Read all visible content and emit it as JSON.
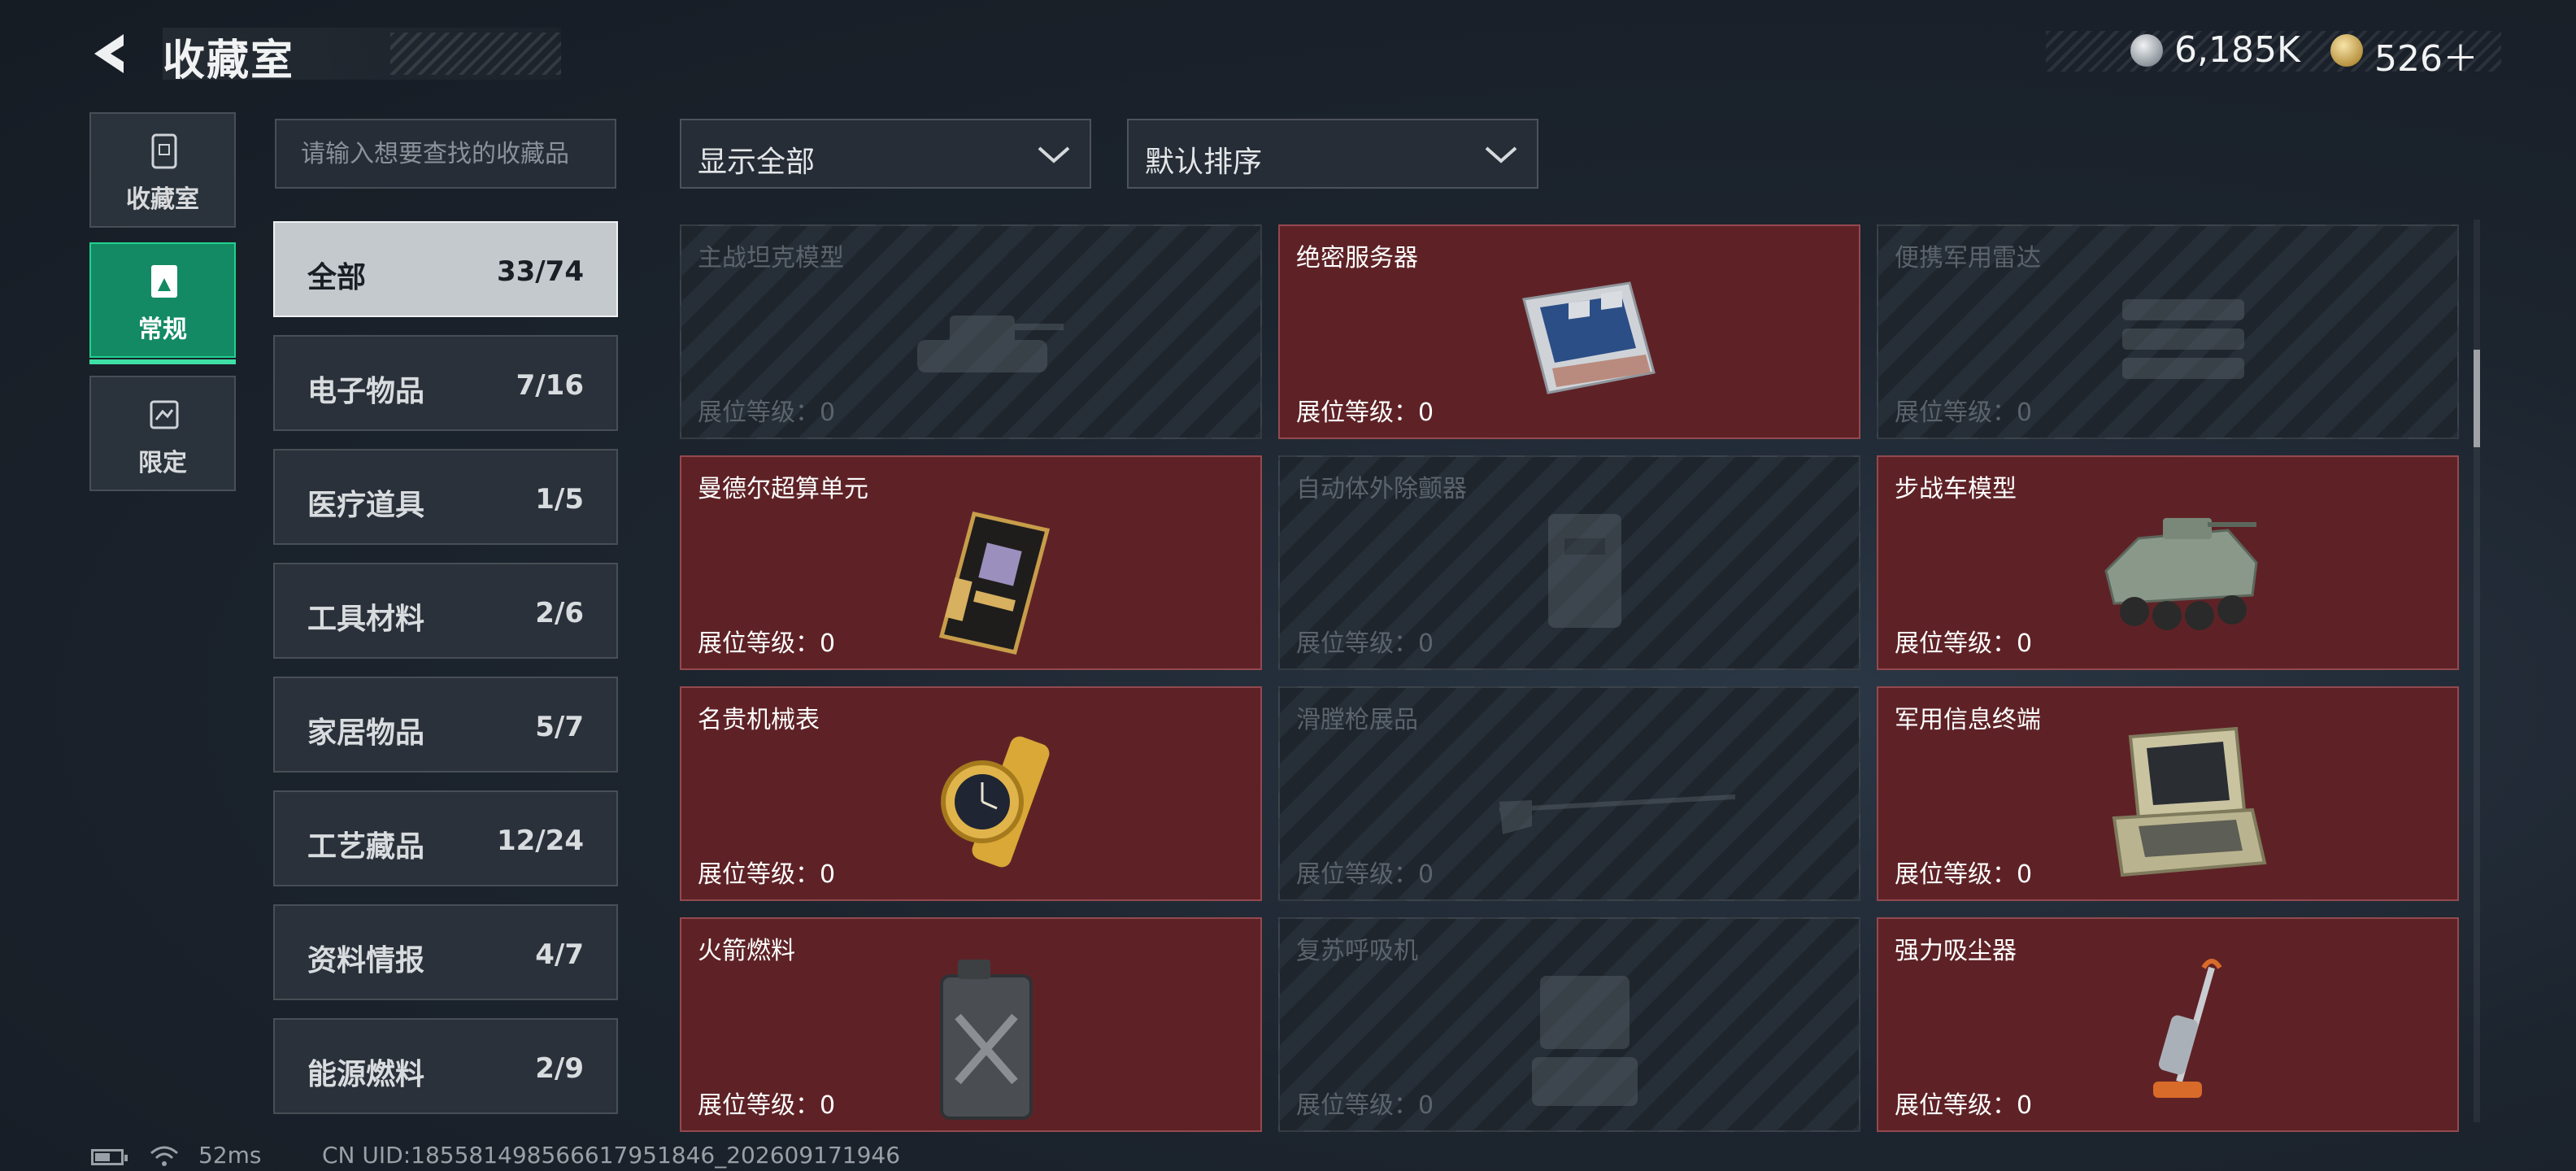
{
  "header": {
    "title": "收藏室",
    "currency1": "6,185K",
    "currency2": "526＋"
  },
  "side_tabs": [
    {
      "label": "收藏室",
      "icon": "archive-icon",
      "active": false
    },
    {
      "label": "常规",
      "icon": "regular-collection-icon",
      "active": true
    },
    {
      "label": "限定",
      "icon": "limited-collection-icon",
      "active": false
    }
  ],
  "search": {
    "placeholder": "请输入想要查找的收藏品"
  },
  "categories": [
    {
      "name": "全部",
      "count": "33/74",
      "active": true
    },
    {
      "name": "电子物品",
      "count": "7/16"
    },
    {
      "name": "医疗道具",
      "count": "1/5"
    },
    {
      "name": "工具材料",
      "count": "2/6"
    },
    {
      "name": "家居物品",
      "count": "5/7"
    },
    {
      "name": "工艺藏品",
      "count": "12/24"
    },
    {
      "name": "资料情报",
      "count": "4/7"
    },
    {
      "name": "能源燃料",
      "count": "2/9"
    }
  ],
  "filters": {
    "show": "显示全部",
    "sort": "默认排序"
  },
  "items": [
    {
      "name": "主战坦克模型",
      "level": "展位等级：0",
      "owned": false,
      "icon": "tank-model-icon"
    },
    {
      "name": "绝密服务器",
      "level": "展位等级：0",
      "owned": true,
      "icon": "server-icon"
    },
    {
      "name": "便携军用雷达",
      "level": "展位等级：0",
      "owned": false,
      "icon": "radar-icon"
    },
    {
      "name": "曼德尔超算单元",
      "level": "展位等级：0",
      "owned": true,
      "icon": "supercomputer-unit-icon"
    },
    {
      "name": "自动体外除颤器",
      "level": "展位等级：0",
      "owned": false,
      "icon": "defibrillator-icon"
    },
    {
      "name": "步战车模型",
      "level": "展位等级：0",
      "owned": true,
      "icon": "ifv-model-icon"
    },
    {
      "name": "名贵机械表",
      "level": "展位等级：0",
      "owned": true,
      "icon": "watch-icon"
    },
    {
      "name": "滑膛枪展品",
      "level": "展位等级：0",
      "owned": false,
      "icon": "musket-icon"
    },
    {
      "name": "军用信息终端",
      "level": "展位等级：0",
      "owned": true,
      "icon": "terminal-icon"
    },
    {
      "name": "火箭燃料",
      "level": "展位等级：0",
      "owned": true,
      "icon": "fuel-can-icon"
    },
    {
      "name": "复苏呼吸机",
      "level": "展位等级：0",
      "owned": false,
      "icon": "ventilator-icon"
    },
    {
      "name": "强力吸尘器",
      "level": "展位等级：0",
      "owned": true,
      "icon": "vacuum-icon"
    }
  ],
  "status": {
    "ping": "52ms",
    "uid": "CN UID:18558149856661795​1846_202609171946"
  },
  "colors": {
    "accent": "#138a63",
    "owned_card": "#5e2226",
    "locked_card": "#232a33"
  }
}
